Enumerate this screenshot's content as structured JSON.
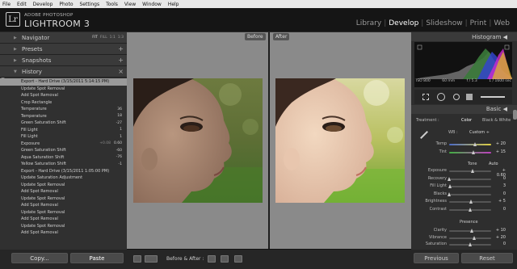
{
  "menu": [
    "File",
    "Edit",
    "Develop",
    "Photo",
    "Settings",
    "Tools",
    "View",
    "Window",
    "Help"
  ],
  "app": {
    "logo": "Lr",
    "brand_top": "ADOBE PHOTOSHOP",
    "brand_name": "LIGHTROOM 3"
  },
  "modules": [
    {
      "label": "Library",
      "active": false
    },
    {
      "label": "Develop",
      "active": true
    },
    {
      "label": "Slideshow",
      "active": false
    },
    {
      "label": "Print",
      "active": false
    },
    {
      "label": "Web",
      "active": false
    }
  ],
  "left_panel": {
    "navigator": {
      "title": "Navigator",
      "options": [
        "FIT",
        "FILL",
        "1:1",
        "1:3"
      ]
    },
    "presets": {
      "title": "Presets",
      "action": "+"
    },
    "snapshots": {
      "title": "Snapshots",
      "action": "+"
    },
    "history": {
      "title": "History",
      "action": "×"
    },
    "history_items": [
      {
        "label": "Export - Hard Drive (3/15/2011 5:14:15 PM)",
        "v1": "",
        "v2": "",
        "selected": true
      },
      {
        "label": "Update Spot Removal",
        "v1": "",
        "v2": ""
      },
      {
        "label": "Add Spot Removal",
        "v1": "",
        "v2": ""
      },
      {
        "label": "Crop Rectangle",
        "v1": "",
        "v2": ""
      },
      {
        "label": "Temperature",
        "v1": "",
        "v2": "36"
      },
      {
        "label": "Temperature",
        "v1": "",
        "v2": "18"
      },
      {
        "label": "Green Saturation Shift",
        "v1": "",
        "v2": "-27"
      },
      {
        "label": "Fill Light",
        "v1": "",
        "v2": "1"
      },
      {
        "label": "Fill Light",
        "v1": "",
        "v2": "1"
      },
      {
        "label": "Exposure",
        "v1": "+0.08",
        "v2": "0.60"
      },
      {
        "label": "Green Saturation Shift",
        "v1": "",
        "v2": "-60"
      },
      {
        "label": "Aqua Saturation Shift",
        "v1": "",
        "v2": "-76"
      },
      {
        "label": "Yellow Saturation Shift",
        "v1": "",
        "v2": "-1"
      },
      {
        "label": "Export - Hard Drive (3/15/2011 1:05:00 PM)",
        "v1": "",
        "v2": ""
      },
      {
        "label": "Update Saturation Adjustment",
        "v1": "",
        "v2": ""
      },
      {
        "label": "Update Spot Removal",
        "v1": "",
        "v2": ""
      },
      {
        "label": "Add Spot Removal",
        "v1": "",
        "v2": ""
      },
      {
        "label": "Update Spot Removal",
        "v1": "",
        "v2": ""
      },
      {
        "label": "Add Spot Removal",
        "v1": "",
        "v2": ""
      },
      {
        "label": "Update Spot Removal",
        "v1": "",
        "v2": ""
      },
      {
        "label": "Add Spot Removal",
        "v1": "",
        "v2": ""
      },
      {
        "label": "Update Spot Removal",
        "v1": "",
        "v2": ""
      },
      {
        "label": "Add Spot Removal",
        "v1": "",
        "v2": ""
      }
    ],
    "copy_label": "Copy...",
    "paste_label": "Paste"
  },
  "center": {
    "before_label": "Before",
    "after_label": "After"
  },
  "toolbar": {
    "before_after_label": "Before & After :"
  },
  "right_panel": {
    "histogram_title": "Histogram",
    "histogram_info": [
      "ISO 800",
      "60 mm",
      "f / 5.3",
      "1 / 1600 sec"
    ],
    "basic_title": "Basic",
    "treatment_label": "Treatment :",
    "treatment_color": "Color",
    "treatment_bw": "Black & White",
    "wb_label": "WB :",
    "wb_value": "Custom ÷",
    "tone_label": "Tone",
    "tone_auto": "Auto",
    "presence_label": "Presence",
    "sliders_wb": [
      {
        "label": "Temp",
        "value": "+ 20",
        "pos": 0.62,
        "track": "temp"
      },
      {
        "label": "Tint",
        "value": "+ 15",
        "pos": 0.58,
        "track": "tint"
      }
    ],
    "sliders_tone": [
      {
        "label": "Exposure",
        "value": "+ 0.60",
        "pos": 0.57
      },
      {
        "label": "Recovery",
        "value": "0",
        "pos": 0.0
      },
      {
        "label": "Fill Light",
        "value": "3",
        "pos": 0.03
      },
      {
        "label": "Blacks",
        "value": "0",
        "pos": 0.0
      },
      {
        "label": "Brightness",
        "value": "+ 5",
        "pos": 0.52
      },
      {
        "label": "Contrast",
        "value": "0",
        "pos": 0.5
      }
    ],
    "sliders_presence": [
      {
        "label": "Clarity",
        "value": "+ 10",
        "pos": 0.55
      },
      {
        "label": "Vibrance",
        "value": "+ 20",
        "pos": 0.6
      },
      {
        "label": "Saturation",
        "value": "0",
        "pos": 0.5
      }
    ],
    "previous_label": "Previous",
    "reset_label": "Reset"
  }
}
